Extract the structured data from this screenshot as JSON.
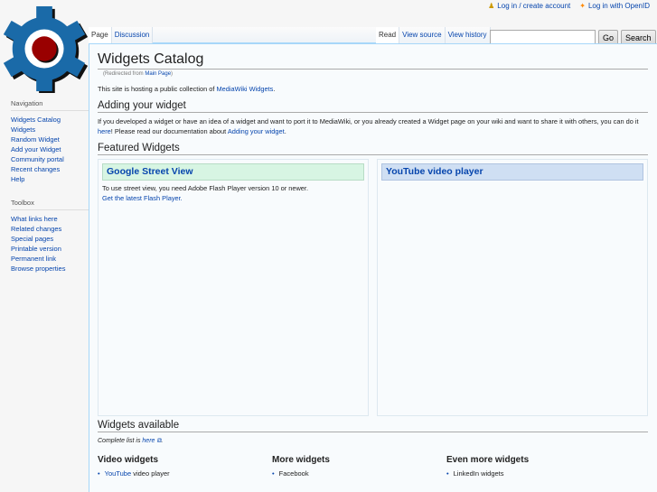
{
  "personal": {
    "login": "Log in / create account",
    "openid": "Log in with OpenID"
  },
  "tabs": {
    "page": "Page",
    "discussion": "Discussion",
    "read": "Read",
    "view_source": "View source",
    "view_history": "View history"
  },
  "search": {
    "value": "",
    "placeholder": "",
    "go": "Go",
    "search": "Search"
  },
  "title": "Widgets Catalog",
  "redirect": {
    "prefix": "(Redirected from ",
    "link": "Main Page",
    "suffix": ")"
  },
  "intro": {
    "text": "This site is hosting a public collection of ",
    "link": "MediaWiki Widgets",
    "end": "."
  },
  "adding": {
    "heading": "Adding your widget",
    "text1": "If you developed a widget or have an idea of a widget and want to port it to MediaWiki, or you already created a Widget page on your wiki and want to share it with others, you can do it ",
    "here": "here",
    "text2": "! Please read our documentation about ",
    "link": "Adding your widget",
    "end": "."
  },
  "featured": {
    "heading": "Featured Widgets",
    "left": {
      "title": "Google Street View",
      "text": "To use street view, you need Adobe Flash Player version 10 or newer.",
      "link": "Get the latest Flash Player."
    },
    "right": {
      "title": "YouTube video player"
    }
  },
  "available": {
    "heading": "Widgets available",
    "complete": "Complete list is ",
    "here": "here",
    "end": ".",
    "cols": [
      {
        "title": "Video widgets",
        "item_link": "YouTube",
        "item_text": " video player"
      },
      {
        "title": "More widgets",
        "item_text": "Facebook"
      },
      {
        "title": "Even more widgets",
        "item_text": "LinkedIn widgets"
      }
    ]
  },
  "sidebar": {
    "navigation": {
      "heading": "Navigation",
      "items": [
        "Widgets Catalog",
        "Widgets",
        "Random Widget",
        "Add your Widget",
        "Community portal",
        "Recent changes",
        "Help"
      ]
    },
    "toolbox": {
      "heading": "Toolbox",
      "items": [
        "What links here",
        "Related changes",
        "Special pages",
        "Printable version",
        "Permanent link",
        "Browse properties"
      ]
    }
  },
  "colors": {
    "link": "#0645ad",
    "logo_blue": "#1a6aa8",
    "logo_red": "#990000"
  }
}
